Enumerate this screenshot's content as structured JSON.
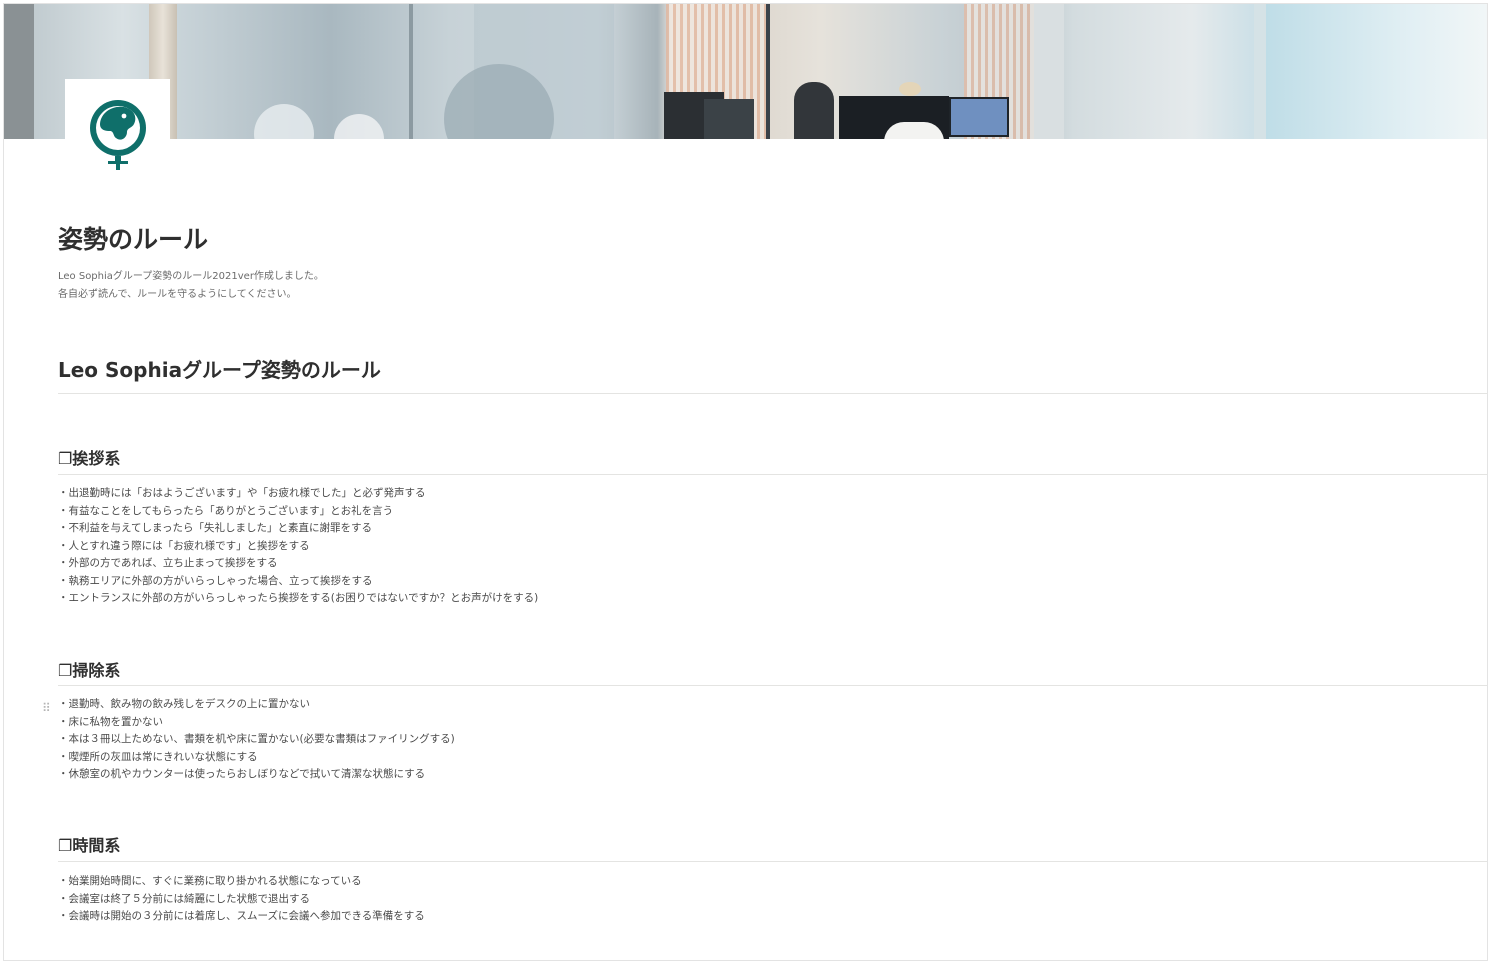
{
  "page": {
    "title": "姿勢のルール",
    "description_lines": [
      "Leo Sophiaグループ姿勢のルール2021ver作成しました。",
      "各自必ず読んで、ルールを守るようにしてください。"
    ],
    "icon": "lion-logo-icon"
  },
  "heading": "Leo Sophiaグループ姿勢のルール",
  "sections": [
    {
      "title": "❐挨拶系",
      "items": [
        "・出退勤時には「おはようございます」や「お疲れ様でした」と必ず発声する",
        "・有益なことをしてもらったら「ありがとうございます」とお礼を言う",
        "・不利益を与えてしまったら「失礼しました」と素直に謝罪をする",
        "・人とすれ違う際には「お疲れ様です」と挨拶をする",
        "・外部の方であれば、立ち止まって挨拶をする",
        "・執務エリアに外部の方がいらっしゃった場合、立って挨拶をする",
        "・エントランスに外部の方がいらっしゃったら挨拶をする(お困りではないですか？とお声がけをする)"
      ]
    },
    {
      "title": "❐掃除系",
      "items": [
        "・退勤時、飲み物の飲み残しをデスクの上に置かない",
        "・床に私物を置かない",
        "・本は３冊以上ためない、書類を机や床に置かない(必要な書類はファイリングする)",
        "・喫煙所の灰皿は常にきれいな状態にする",
        "・休憩室の机やカウンターは使ったらおしぼりなどで拭いて清潔な状態にする"
      ]
    },
    {
      "title": "❐時間系",
      "items": [
        "・始業開始時間に、すぐに業務に取り掛かれる状態になっている",
        "・会議室は終了５分前には綺麗にした状態で退出する",
        "・会議時は開始の３分前には着席し、スムーズに会議へ参加できる準備をする"
      ]
    }
  ],
  "colors": {
    "logo_teal": "#0f6f6a",
    "text": "#37352f",
    "divider": "#e4e4e2"
  }
}
